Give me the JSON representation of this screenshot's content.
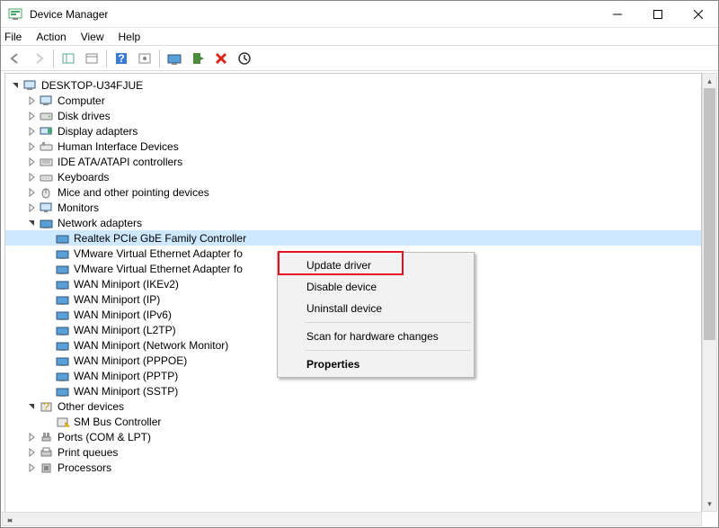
{
  "window": {
    "title": "Device Manager"
  },
  "menu": {
    "file": "File",
    "action": "Action",
    "view": "View",
    "help": "Help"
  },
  "root": {
    "name": "DESKTOP-U34FJUE"
  },
  "categories": [
    {
      "id": "computer",
      "label": "Computer",
      "expanded": false
    },
    {
      "id": "disk-drives",
      "label": "Disk drives",
      "expanded": false
    },
    {
      "id": "display-adapters",
      "label": "Display adapters",
      "expanded": false
    },
    {
      "id": "hid",
      "label": "Human Interface Devices",
      "expanded": false
    },
    {
      "id": "ide",
      "label": "IDE ATA/ATAPI controllers",
      "expanded": false
    },
    {
      "id": "keyboards",
      "label": "Keyboards",
      "expanded": false
    },
    {
      "id": "mice",
      "label": "Mice and other pointing devices",
      "expanded": false
    },
    {
      "id": "monitors",
      "label": "Monitors",
      "expanded": false
    },
    {
      "id": "network",
      "label": "Network adapters",
      "expanded": true
    },
    {
      "id": "other",
      "label": "Other devices",
      "expanded": true
    },
    {
      "id": "ports",
      "label": "Ports (COM & LPT)",
      "expanded": false
    },
    {
      "id": "print-queues",
      "label": "Print queues",
      "expanded": false
    },
    {
      "id": "processors",
      "label": "Processors",
      "expanded": false
    }
  ],
  "network_children": [
    "Realtek PCIe GbE Family Controller",
    "VMware Virtual Ethernet Adapter fo",
    "VMware Virtual Ethernet Adapter fo",
    "WAN Miniport (IKEv2)",
    "WAN Miniport (IP)",
    "WAN Miniport (IPv6)",
    "WAN Miniport (L2TP)",
    "WAN Miniport (Network Monitor)",
    "WAN Miniport (PPPOE)",
    "WAN Miniport (PPTP)",
    "WAN Miniport (SSTP)"
  ],
  "other_children": [
    "SM Bus Controller"
  ],
  "context_menu": {
    "update": "Update driver",
    "disable": "Disable device",
    "uninstall": "Uninstall device",
    "scan": "Scan for hardware changes",
    "properties": "Properties"
  }
}
